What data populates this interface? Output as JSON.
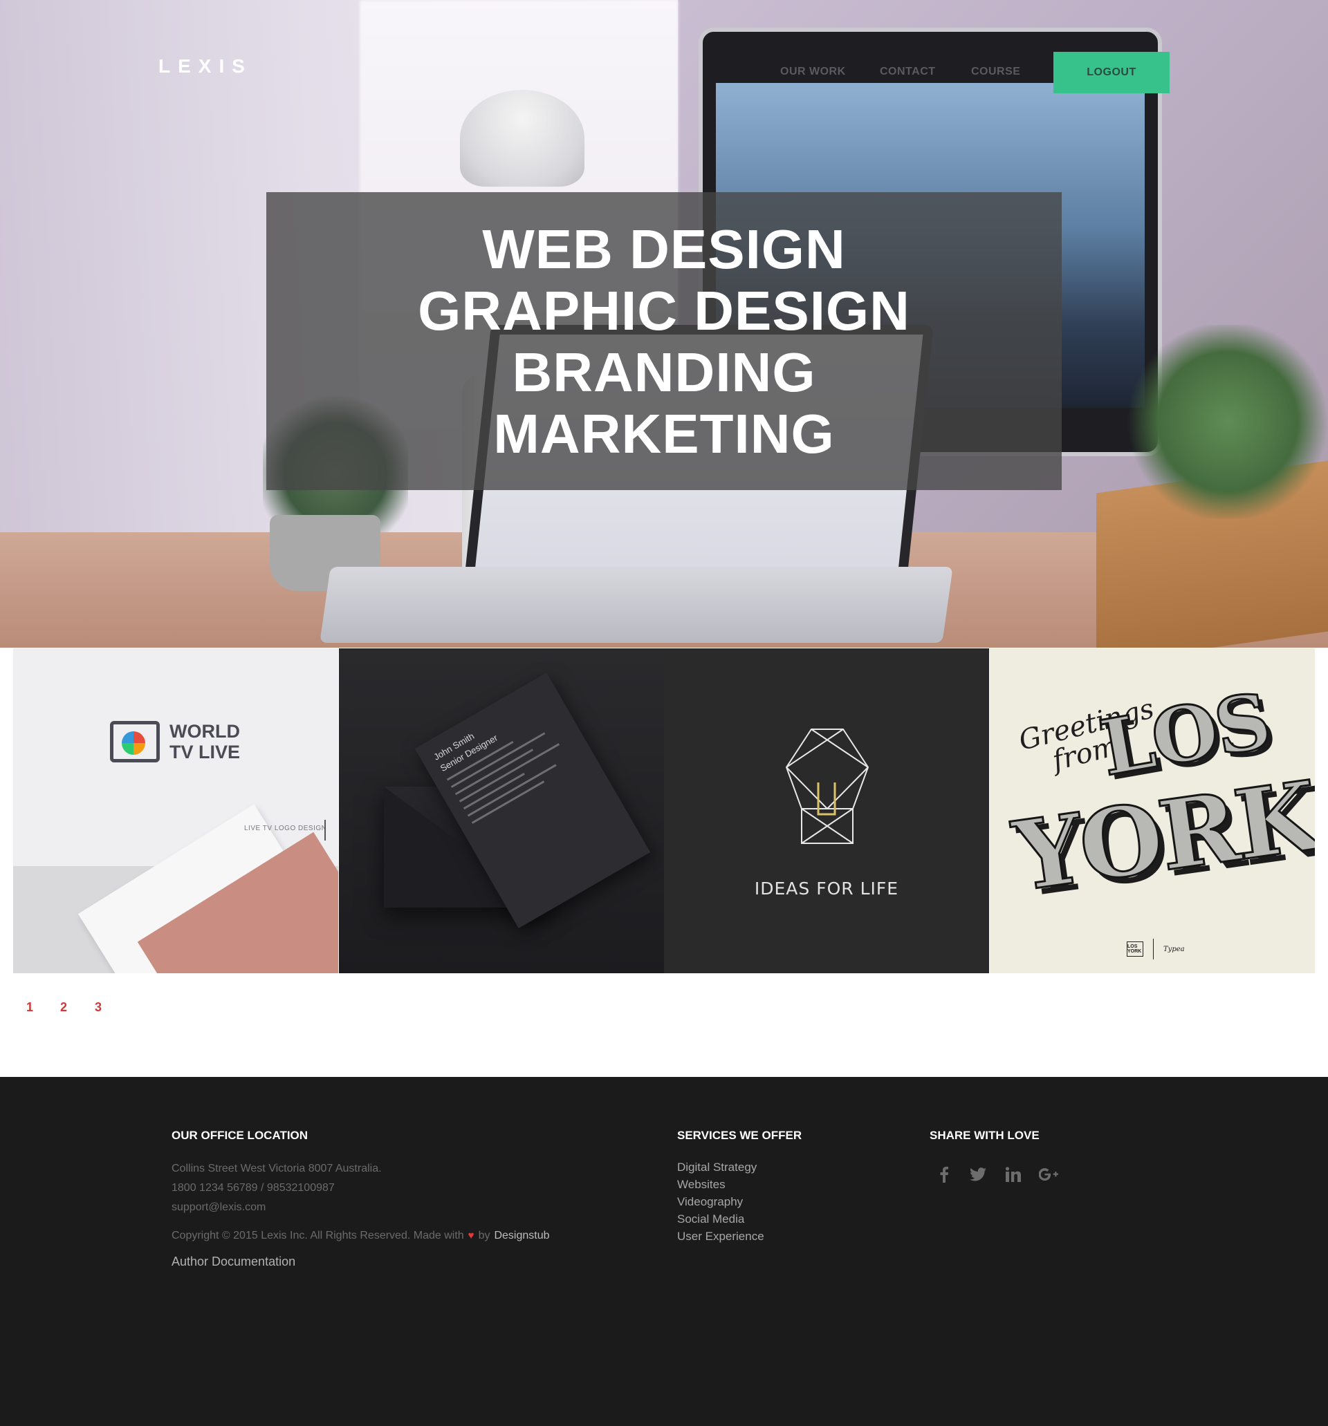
{
  "header": {
    "logo": "LEXIS",
    "nav": [
      {
        "label": "OUR WORK"
      },
      {
        "label": "CONTACT"
      },
      {
        "label": "COURSE"
      }
    ],
    "logout_label": "LOGOUT",
    "accent_color": "#37c28c"
  },
  "hero": {
    "lines": [
      "WEB DESIGN",
      "GRAPHIC DESIGN",
      "BRANDING",
      "MARKETING"
    ]
  },
  "portfolio": {
    "tiles": [
      {
        "brand_line1": "WORLD",
        "brand_line2": "TV LIVE",
        "caption": "LIVE TV  LOGO DESIGN"
      },
      {
        "name": "John Smith",
        "role": "Senior Designer"
      },
      {
        "text": "IDEAS FOR LIFE"
      },
      {
        "greeting_line1": "Greetings",
        "greeting_line2": "from",
        "word1": "LOS",
        "word2": "YORK",
        "mark": "LOS YORK",
        "signature": "Typea"
      }
    ]
  },
  "pagination": {
    "pages": [
      "1",
      "2",
      "3"
    ],
    "color": "#d23838"
  },
  "footer": {
    "office": {
      "heading": "OUR OFFICE LOCATION",
      "address": "Collins Street West Victoria 8007 Australia.",
      "phones": "1800 1234 56789 / 98532100987",
      "email": "support@lexis.com",
      "copyright_prefix": "Copyright © 2015 Lexis Inc. All Rights Reserved. Made with",
      "heart": "♥",
      "by": "by",
      "designer": "Designstub",
      "doc_link": "Author Documentation"
    },
    "services": {
      "heading": "SERVICES WE OFFER",
      "items": [
        "Digital Strategy",
        "Websites",
        "Videography",
        "Social Media",
        "User Experience"
      ]
    },
    "share": {
      "heading": "SHARE WITH LOVE",
      "icons": [
        "facebook-icon",
        "twitter-icon",
        "linkedin-icon",
        "google-plus-icon"
      ]
    }
  }
}
